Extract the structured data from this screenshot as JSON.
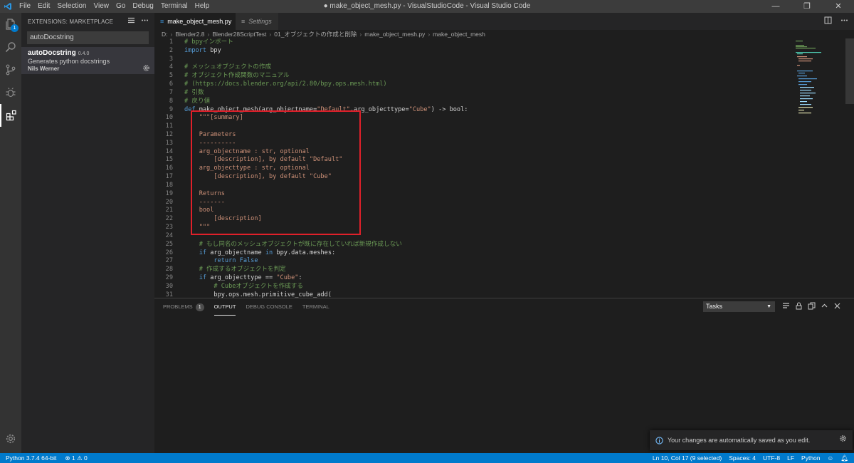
{
  "window": {
    "title": "● make_object_mesh.py - VisualStudioCode - Visual Studio Code",
    "menu": [
      "File",
      "Edit",
      "Selection",
      "View",
      "Go",
      "Debug",
      "Terminal",
      "Help"
    ],
    "controls": [
      "—",
      "❐",
      "✕"
    ]
  },
  "activity": {
    "extensions_badge": "1"
  },
  "sidebar": {
    "header": "EXTENSIONS: MARKETPLACE",
    "search_value": "autoDocstring",
    "extension": {
      "name": "autoDocstring",
      "version": "0.4.0",
      "description": "Generates python docstrings",
      "publisher": "Nils Werner"
    }
  },
  "tabs": [
    {
      "label": "make_object_mesh.py",
      "dirty": true
    },
    {
      "label": "Settings"
    }
  ],
  "breadcrumb": [
    "D:",
    "Blender2.8",
    "Blender28ScriptTest",
    "01_オブジェクトの作成と削除",
    "make_object_mesh.py",
    "make_object_mesh"
  ],
  "code_lines": [
    {
      "n": "1",
      "t": "# bpyインポート"
    },
    {
      "n": "2",
      "t": "import bpy"
    },
    {
      "n": "3",
      "t": ""
    },
    {
      "n": "4",
      "t": "# メッシュオブジェクトの作成"
    },
    {
      "n": "5",
      "t": "# オブジェクト作成関数のマニュアル"
    },
    {
      "n": "6",
      "t": "# (https://docs.blender.org/api/2.80/bpy.ops.mesh.html)"
    },
    {
      "n": "7",
      "t": "# 引数"
    },
    {
      "n": "8",
      "t": "# 戻り値"
    },
    {
      "n": "9",
      "t": "def make_object_mesh(arg_objectname=\"Default\",arg_objecttype=\"Cube\") -> bool:"
    },
    {
      "n": "10",
      "t": "    \"\"\"[summary]"
    },
    {
      "n": "11",
      "t": ""
    },
    {
      "n": "12",
      "t": "    Parameters"
    },
    {
      "n": "13",
      "t": "    ----------"
    },
    {
      "n": "14",
      "t": "    arg_objectname : str, optional"
    },
    {
      "n": "15",
      "t": "        [description], by default \"Default\""
    },
    {
      "n": "16",
      "t": "    arg_objecttype : str, optional"
    },
    {
      "n": "17",
      "t": "        [description], by default \"Cube\""
    },
    {
      "n": "18",
      "t": ""
    },
    {
      "n": "19",
      "t": "    Returns"
    },
    {
      "n": "20",
      "t": "    -------"
    },
    {
      "n": "21",
      "t": "    bool"
    },
    {
      "n": "22",
      "t": "        [description]"
    },
    {
      "n": "23",
      "t": "    \"\"\""
    },
    {
      "n": "24",
      "t": ""
    },
    {
      "n": "25",
      "t": "    # もし同名のメッシュオブジェクトが既に存在していれば新規作成しない"
    },
    {
      "n": "26",
      "t": "    if arg_objectname in bpy.data.meshes:"
    },
    {
      "n": "27",
      "t": "        return False"
    },
    {
      "n": "28",
      "t": "    # 作成するオブジェクトを判定"
    },
    {
      "n": "29",
      "t": "    if arg_objecttype == \"Cube\":"
    },
    {
      "n": "30",
      "t": "        # Cubeオブジェクトを作成する"
    },
    {
      "n": "31",
      "t": "        bpy.ops.mesh.primitive_cube_add("
    }
  ],
  "panel": {
    "tabs": [
      "PROBLEMS",
      "OUTPUT",
      "DEBUG CONSOLE",
      "TERMINAL"
    ],
    "problems_count": "1",
    "active_tab": "OUTPUT",
    "select_value": "Tasks"
  },
  "toast": {
    "message": "Your changes are automatically saved as you edit."
  },
  "status": {
    "interpreter": "Python 3.7.4 64-bit",
    "errors": "1",
    "warnings": "0",
    "position": "Ln 10, Col 17 (9 selected)",
    "spaces": "Spaces: 4",
    "encoding": "UTF-8",
    "eol": "LF",
    "language": "Python"
  },
  "colors": {
    "accent": "#007acc",
    "highlight_box": "#e0202a",
    "comment": "#6a9955",
    "keyword": "#569cd6",
    "string": "#ce9178",
    "function": "#dcdcaa"
  }
}
